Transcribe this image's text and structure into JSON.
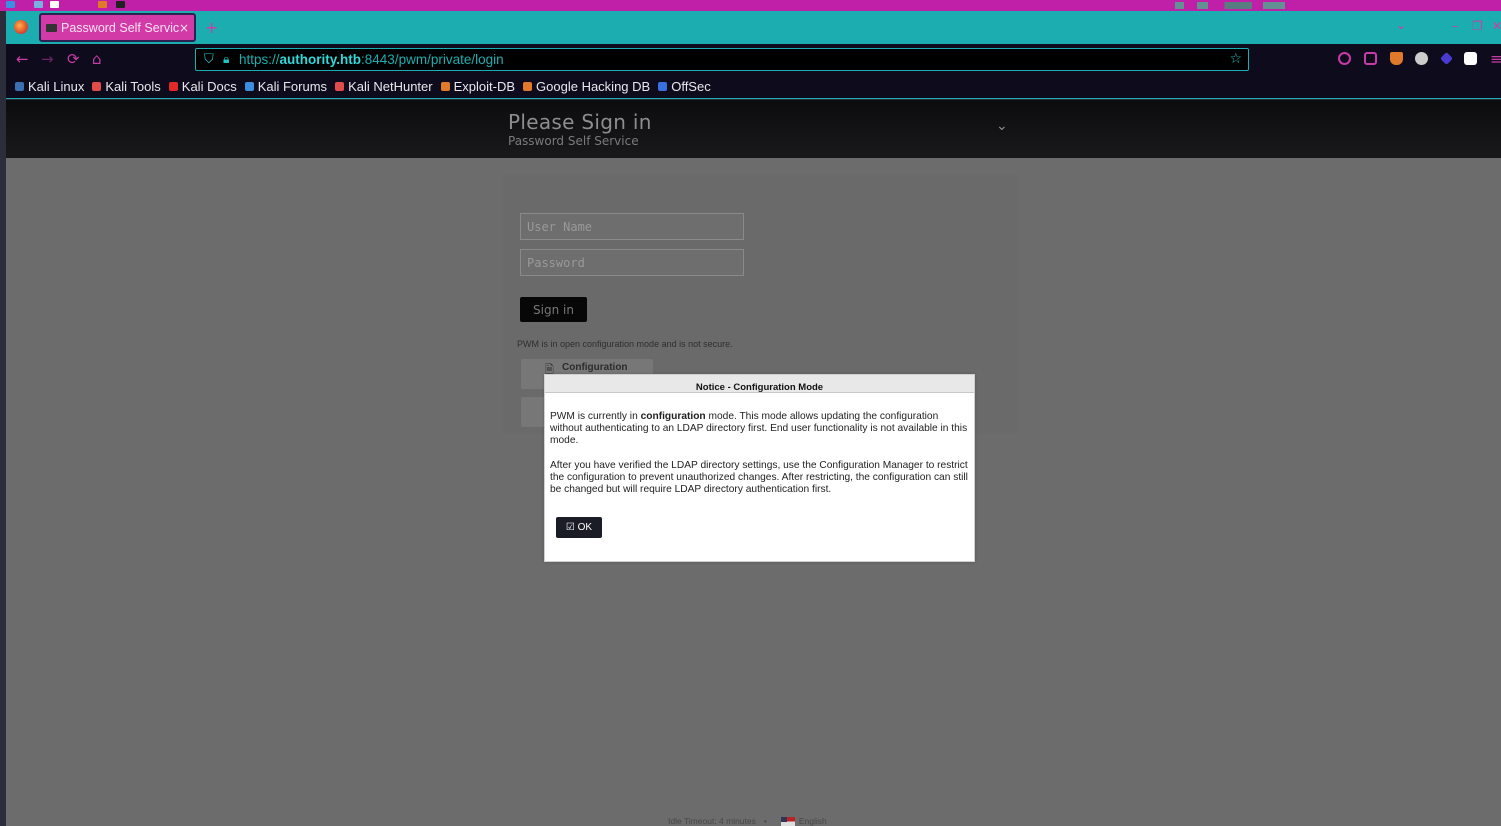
{
  "browser": {
    "tab_title": "Password Self Service",
    "tab_close": "×",
    "new_tab": "+",
    "tab_list": "⌄",
    "window_controls": [
      "–",
      "❐",
      "✕"
    ],
    "url_prefix": "https://",
    "url_host": "authority.htb",
    "url_rest": ":8443/pwm/private/login",
    "nav": {
      "back": "←",
      "forward": "→",
      "reload": "⟳",
      "home": "⌂"
    },
    "bookmarks": [
      {
        "label": "Kali Linux",
        "icon": "kali-dragon-icon",
        "color": "#3a6fb0"
      },
      {
        "label": "Kali Tools",
        "icon": "kali-tools-icon",
        "color": "#e04c4c"
      },
      {
        "label": "Kali Docs",
        "icon": "kali-docs-icon",
        "color": "#e02a2a"
      },
      {
        "label": "Kali Forums",
        "icon": "kali-forums-icon",
        "color": "#3a8fe0"
      },
      {
        "label": "Kali NetHunter",
        "icon": "nethunter-icon",
        "color": "#e04c4c"
      },
      {
        "label": "Exploit-DB",
        "icon": "exploit-db-icon",
        "color": "#e07a2a"
      },
      {
        "label": "Google Hacking DB",
        "icon": "ghdb-icon",
        "color": "#e07a2a"
      },
      {
        "label": "OffSec",
        "icon": "offsec-icon",
        "color": "#3a6fe0"
      }
    ],
    "colors": {
      "tab_bar": "#1cadb0",
      "accent": "#d23aa7",
      "top_panel": "#c01fa8"
    }
  },
  "page": {
    "title": "Please Sign in",
    "subtitle": "Password Self Service",
    "username_placeholder": "User Name",
    "password_placeholder": "Password",
    "signin_label": "Sign in",
    "open_config_notice": "PWM is in open configuration mode and is not secure.",
    "config_button_label": "Configuration",
    "footer_idle": "Idle Timeout: 4 minutes",
    "footer_separator": "•",
    "footer_language": "English"
  },
  "dialog": {
    "title": "Notice - Configuration Mode",
    "p1_before": "PWM is currently in ",
    "p1_bold": "configuration",
    "p1_after": " mode. This mode allows updating the configuration without authenticating to an LDAP directory first. End user functionality is not available in this mode.",
    "p2": "After you have verified the LDAP directory settings, use the Configuration Manager to restrict the configuration to prevent unauthorized changes. After restricting, the configuration can still be changed but will require LDAP directory authentication first.",
    "ok_icon": "☑",
    "ok_label": "OK"
  }
}
